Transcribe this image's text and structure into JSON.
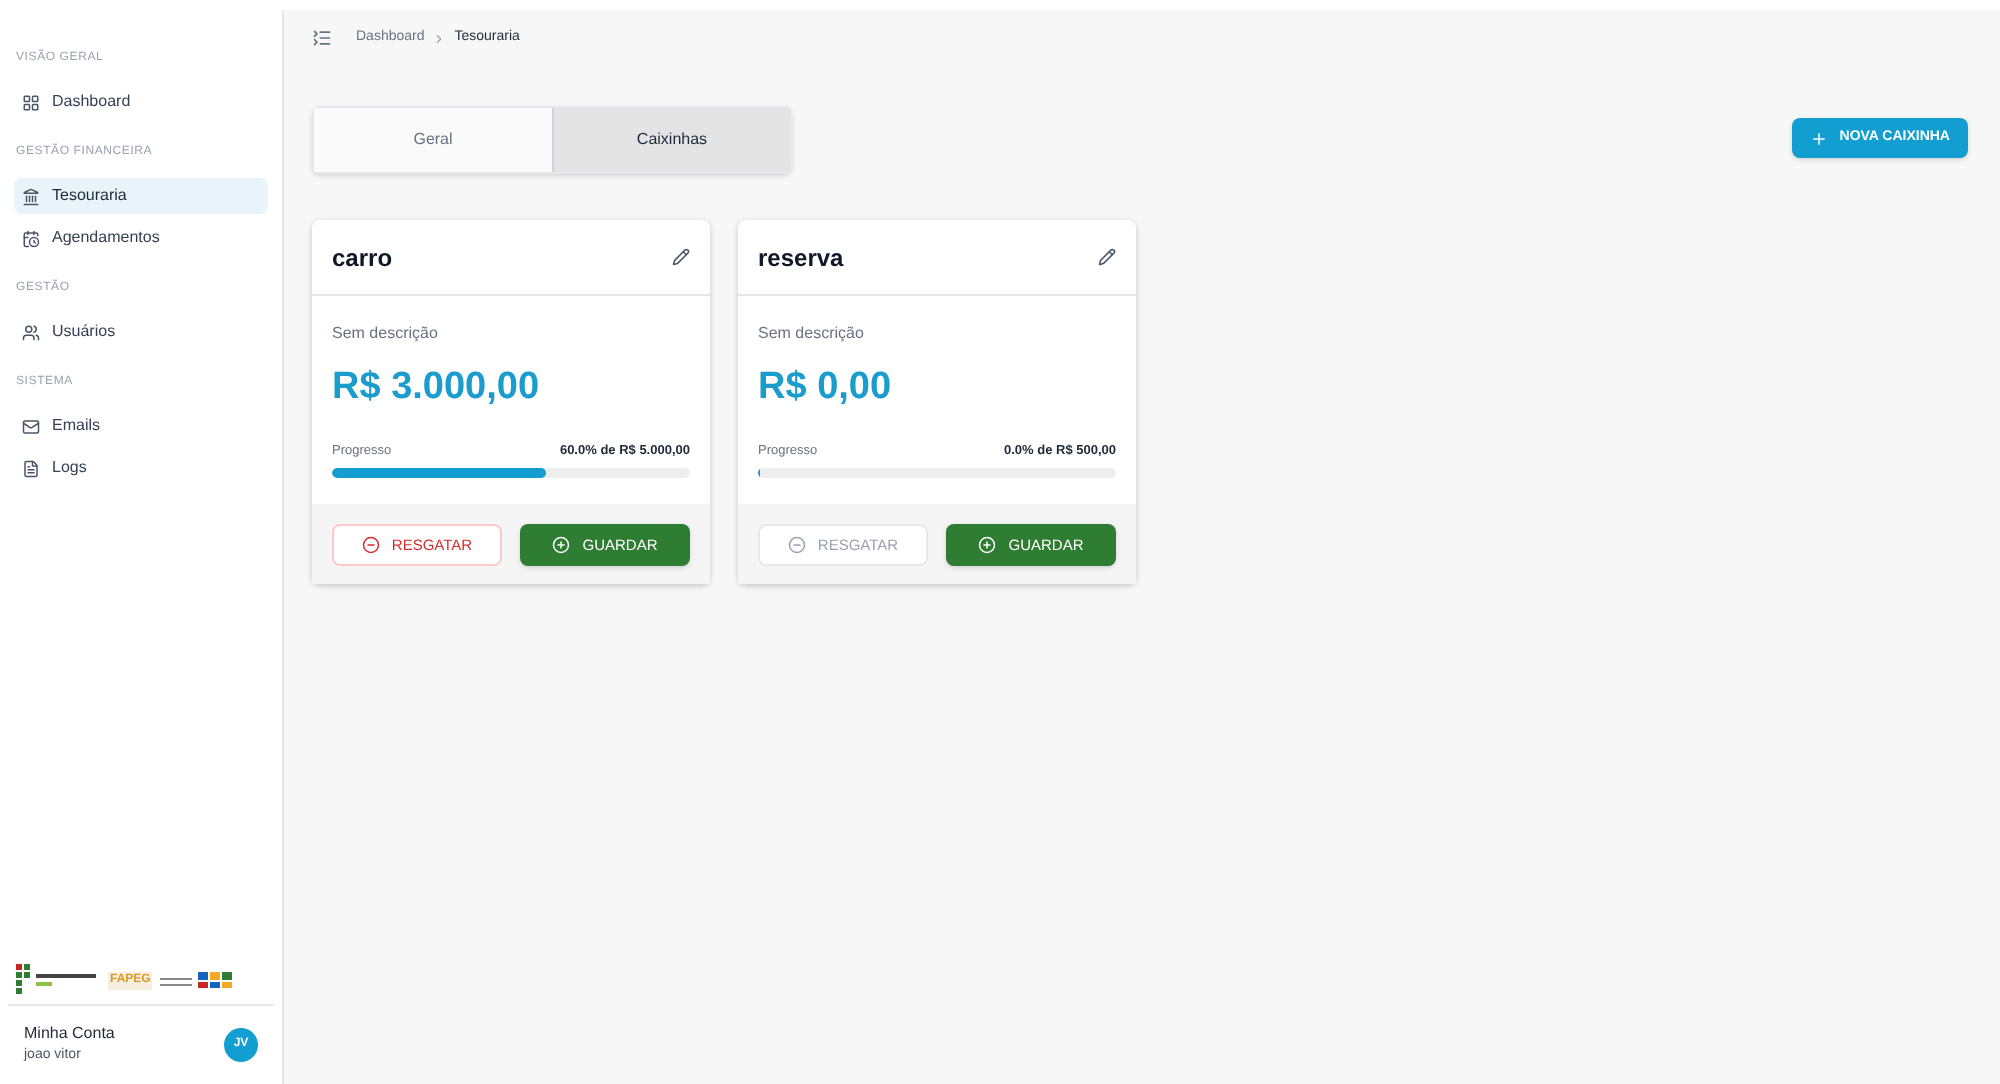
{
  "sidebar": {
    "sections": [
      {
        "title": "VISÃO GERAL",
        "items": [
          {
            "label": "Dashboard",
            "kind": "dashboard",
            "selected": false
          }
        ]
      },
      {
        "title": "GESTÃO FINANCEIRA",
        "items": [
          {
            "label": "Tesouraria",
            "kind": "bank",
            "selected": true
          },
          {
            "label": "Agendamentos",
            "kind": "calendar",
            "selected": false
          }
        ]
      },
      {
        "title": "GESTÃO",
        "items": [
          {
            "label": "Usuários",
            "kind": "users",
            "selected": false
          }
        ]
      },
      {
        "title": "SISTEMA",
        "items": [
          {
            "label": "Emails",
            "kind": "mail",
            "selected": false
          },
          {
            "label": "Logs",
            "kind": "file",
            "selected": false
          }
        ]
      }
    ],
    "logos": {
      "fapeg": "FAPEG"
    },
    "account": {
      "title": "Minha Conta",
      "user": "joao vitor",
      "initials": "JV"
    }
  },
  "breadcrumb": [
    "Dashboard",
    "Tesouraria"
  ],
  "tabs": [
    {
      "label": "Geral",
      "selected": false
    },
    {
      "label": "Caixinhas",
      "selected": true
    }
  ],
  "new_button": "NOVA CAIXINHA",
  "cards": [
    {
      "name": "carro",
      "description": "Sem descrição",
      "amount": "R$ 3.000,00",
      "progress_label": "Progresso",
      "progress_text": "60.0% de R$ 5.000,00",
      "level": 0.6,
      "withdraw": {
        "label": "RESGATAR",
        "disabled": false
      },
      "save": "GUARDAR"
    },
    {
      "name": "reserva",
      "description": "Sem descrição",
      "amount": "R$ 0,00",
      "progress_label": "Progresso",
      "progress_text": "0.0% de R$ 500,00",
      "level": 0.0,
      "withdraw": {
        "label": "RESGATAR",
        "disabled": true
      },
      "save": "GUARDAR"
    }
  ]
}
